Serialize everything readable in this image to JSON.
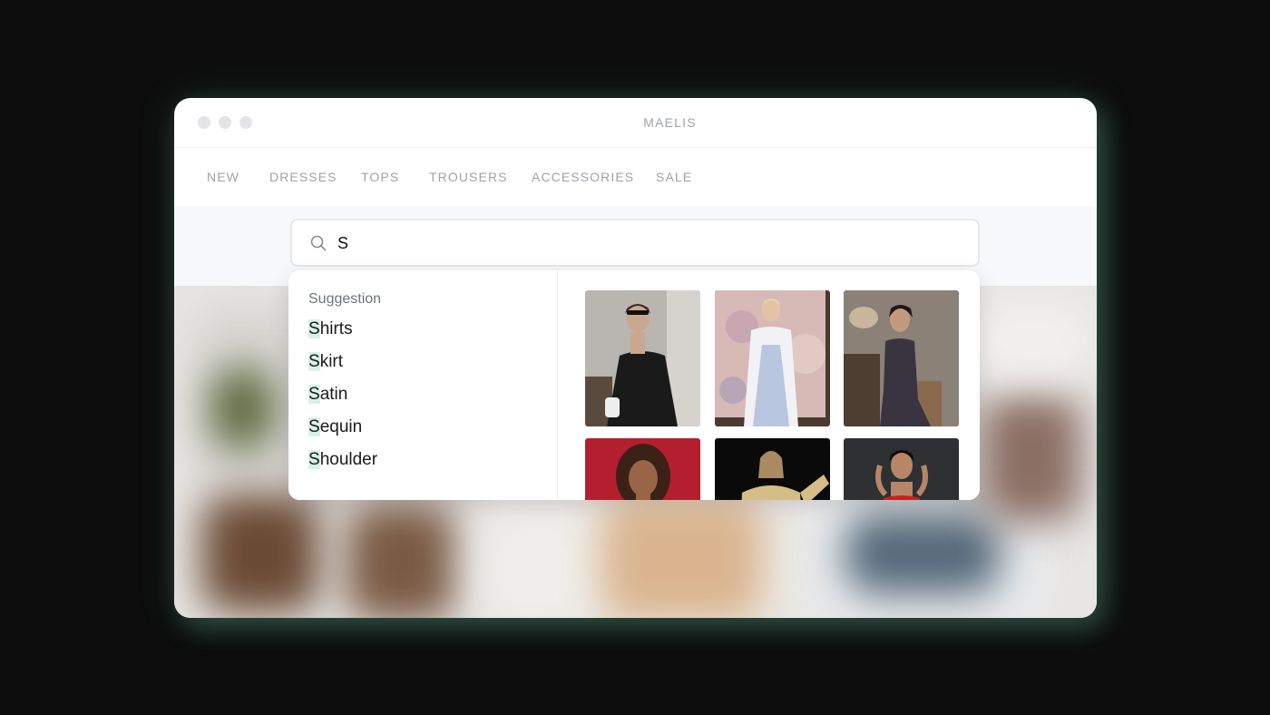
{
  "window": {
    "title": "MAELIS"
  },
  "nav": {
    "items": [
      "NEW",
      "DRESSES",
      "TOPS",
      "TROUSERS",
      "ACCESSORIES",
      "SALE"
    ]
  },
  "search": {
    "value": "S",
    "icon": "search-icon"
  },
  "suggestions": {
    "heading": "Suggestion",
    "items": [
      {
        "match": "S",
        "rest": "hirts"
      },
      {
        "match": "S",
        "rest": "kirt"
      },
      {
        "match": "S",
        "rest": "atin"
      },
      {
        "match": "S",
        "rest": "equin"
      },
      {
        "match": "S",
        "rest": "houlder"
      }
    ]
  },
  "colors": {
    "accent_highlight": "#d9f1ea",
    "glow": "#6ec8aa",
    "nav_text": "#9ea2a8"
  }
}
